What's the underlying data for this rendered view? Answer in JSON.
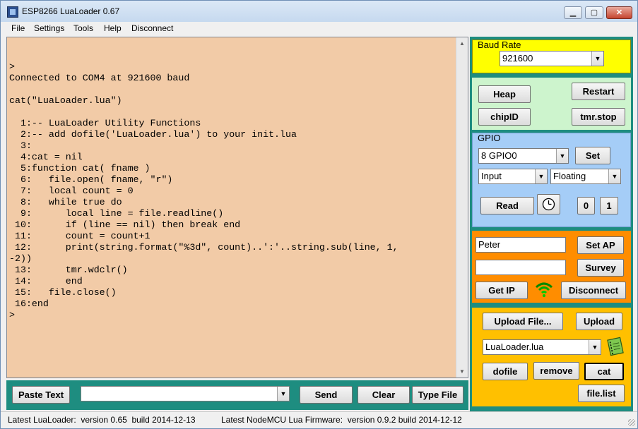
{
  "window": {
    "title": "ESP8266 LuaLoader 0.67",
    "controls": {
      "minimize": "▁",
      "maximize": "▢",
      "close": "✕"
    }
  },
  "menu": [
    "File",
    "Settings",
    "Tools",
    "Help",
    "Disconnect"
  ],
  "console": {
    "lines": [
      ">",
      "Connected to COM4 at 921600 baud",
      "",
      "cat(\"LuaLoader.lua\")",
      "",
      "  1:-- LuaLoader Utility Functions",
      "  2:-- add dofile('LuaLoader.lua') to your init.lua",
      "  3:",
      "  4:cat = nil",
      "  5:function cat( fname )",
      "  6:   file.open( fname, \"r\")",
      "  7:   local count = 0",
      "  8:   while true do",
      "  9:      local line = file.readline()",
      " 10:      if (line == nil) then break end",
      " 11:      count = count+1",
      " 12:      print(string.format(\"%3d\", count)..':'..string.sub(line, 1,",
      "-2))",
      " 13:      tmr.wdclr()",
      " 14:      end",
      " 15:   file.close()",
      " 16:end",
      ">"
    ]
  },
  "bottom": {
    "paste_text": "Paste Text",
    "input_value": "",
    "send": "Send",
    "clear": "Clear",
    "type_file": "Type File"
  },
  "baud": {
    "label": "Baud Rate",
    "value": "921600"
  },
  "control": {
    "heap": "Heap",
    "restart": "Restart",
    "chipid": "chipID",
    "tmr_stop": "tmr.stop"
  },
  "gpio": {
    "label": "GPIO",
    "pin": "8 GPIO0",
    "set": "Set",
    "mode": "Input",
    "pull": "Floating",
    "read": "Read",
    "zero": "0",
    "one": "1"
  },
  "wifi": {
    "ssid": "Peter",
    "password": "",
    "set_ap": "Set AP",
    "survey": "Survey",
    "get_ip": "Get IP",
    "disconnect": "Disconnect"
  },
  "file": {
    "upload_file": "Upload File...",
    "upload": "Upload",
    "filename": "LuaLoader.lua",
    "dofile": "dofile",
    "remove": "remove",
    "cat": "cat",
    "file_list": "file.list"
  },
  "status": {
    "left": "Latest LuaLoader:  version 0.65  build 2014-12-13",
    "right": "Latest NodeMCU Lua Firmware:  version 0.9.2 build 2014-12-12"
  },
  "colors": {
    "console_bg": "#f2cba7",
    "panel_teal": "#1e8d80",
    "baud_yellow": "#ffff00",
    "control_green": "#cdf4cd",
    "gpio_blue": "#a5cdf7",
    "wifi_orange": "#ff8d00",
    "file_amber": "#ffc000"
  }
}
